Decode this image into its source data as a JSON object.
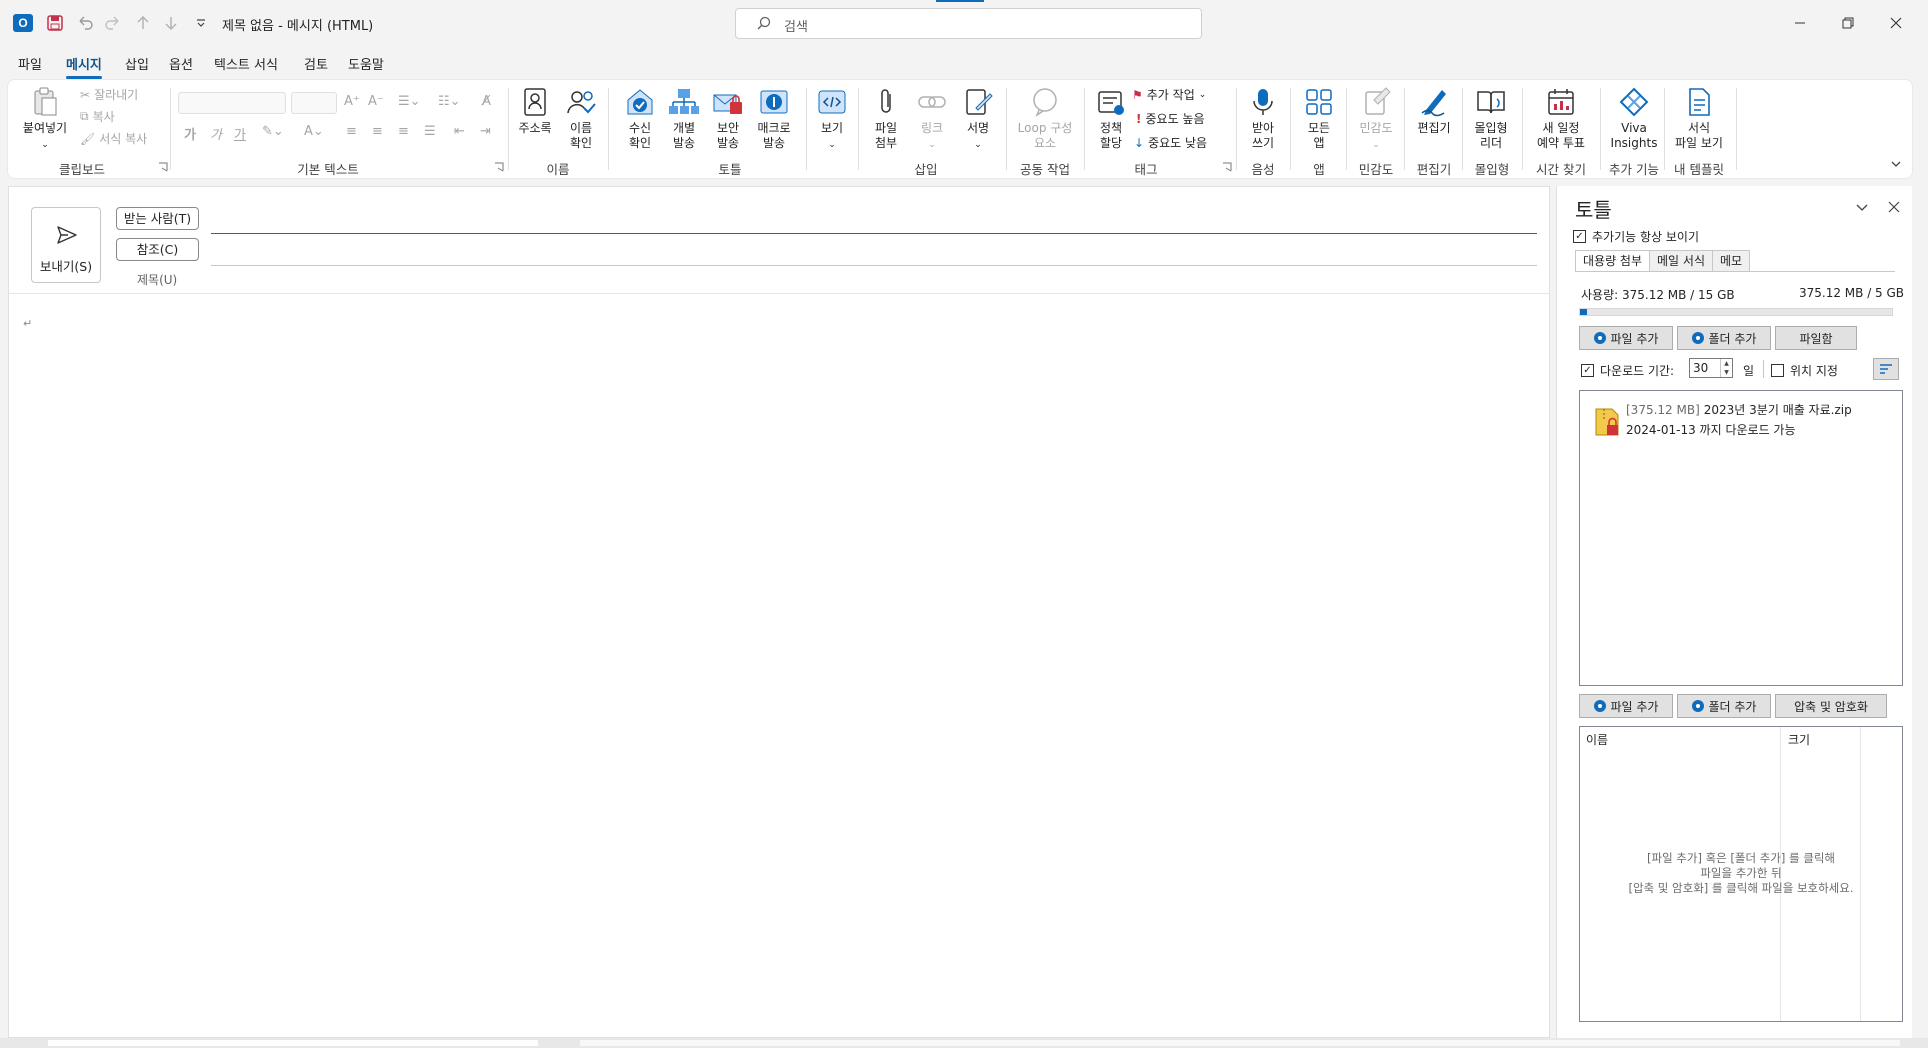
{
  "window": {
    "title": "제목 없음  -  메시지 (HTML)",
    "search_placeholder": "검색"
  },
  "menu_tabs": [
    "파일",
    "메시지",
    "삽입",
    "옵션",
    "텍스트 서식",
    "검토",
    "도움말"
  ],
  "ribbon": {
    "clipboard": {
      "paste": "붙여넣기",
      "cut": "잘라내기",
      "copy": "복사",
      "format_painter": "서식 복사",
      "group": "클립보드"
    },
    "basic_text": {
      "group": "기본 텍스트",
      "bold": "가",
      "italic": "가",
      "underline": "가"
    },
    "names": {
      "address_book": "주소록",
      "check_names": "이름\n확인",
      "group": "이름"
    },
    "toteul": {
      "read_receipt": "수신\n확인",
      "individual_send": "개별\n발송",
      "secure_send": "보안\n발송",
      "macro_send": "매크로\n발송",
      "group": "토틀"
    },
    "view": {
      "label": "보기"
    },
    "insert": {
      "attach_file": "파일\n첨부",
      "link": "링크",
      "signature": "서명",
      "group": "삽입"
    },
    "collab": {
      "loop": "Loop 구성\n요소",
      "group": "공동 작업"
    },
    "tags": {
      "policy": "정책\n할당",
      "followup": "추가 작업",
      "high": "중요도 높음",
      "low": "중요도 낮음",
      "group": "태그"
    },
    "voice": {
      "dictate": "받아\n쓰기",
      "group": "음성"
    },
    "apps": {
      "all_apps": "모든\n앱",
      "group": "앱"
    },
    "sensitivity": {
      "label": "민감도",
      "group": "민감도"
    },
    "editor": {
      "label": "편집기",
      "group": "편집기"
    },
    "immersive": {
      "label": "몰입형\n리더",
      "group": "몰입형"
    },
    "scheduling": {
      "label": "새 일정\n예약 투표",
      "group": "시간 찾기"
    },
    "addins": {
      "viva": "Viva\nInsights",
      "group": "추가 기능"
    },
    "templates": {
      "label": "서식\n파일 보기",
      "group": "내 템플릿"
    }
  },
  "compose": {
    "send": "보내기(S)",
    "to": "받는 사람(T)",
    "cc": "참조(C)",
    "subject": "제목(U)",
    "para_mark": "↵"
  },
  "panel": {
    "title": "토틀",
    "always_show": "추가기능 항상 보이기",
    "tabs": [
      "대용량 첨부",
      "메일 서식",
      "메모"
    ],
    "usage_left": "사용량: 375.12 MB / 15 GB",
    "usage_right": "375.12 MB / 5 GB",
    "usage_fraction": 0.024,
    "add_file": "파일 추가",
    "add_folder": "폴더 추가",
    "file_box": "파일함",
    "download_period": "다운로드 기간:",
    "download_days": "30",
    "day_unit": "일",
    "set_location": "위치 지정",
    "file": {
      "size": "[375.12 MB]",
      "name": "2023년 3분기 매출 자료.zip",
      "expiry": "2024-01-13 까지 다운로드 가능"
    },
    "compress_encrypt": "압축 및 암호화",
    "col_name": "이름",
    "col_size": "크기",
    "empty_line1": "[파일 추가] 혹은 [폴더 추가] 를 클릭해",
    "empty_line2": "파일을 추가한 뒤",
    "empty_line3": "[압축 및 암호화] 를 클릭해 파일을 보호하세요."
  },
  "colors": {
    "accent": "#0f6cbd",
    "ribbon_bg": "#ffffff",
    "chrome_bg": "#f3f3f3"
  }
}
